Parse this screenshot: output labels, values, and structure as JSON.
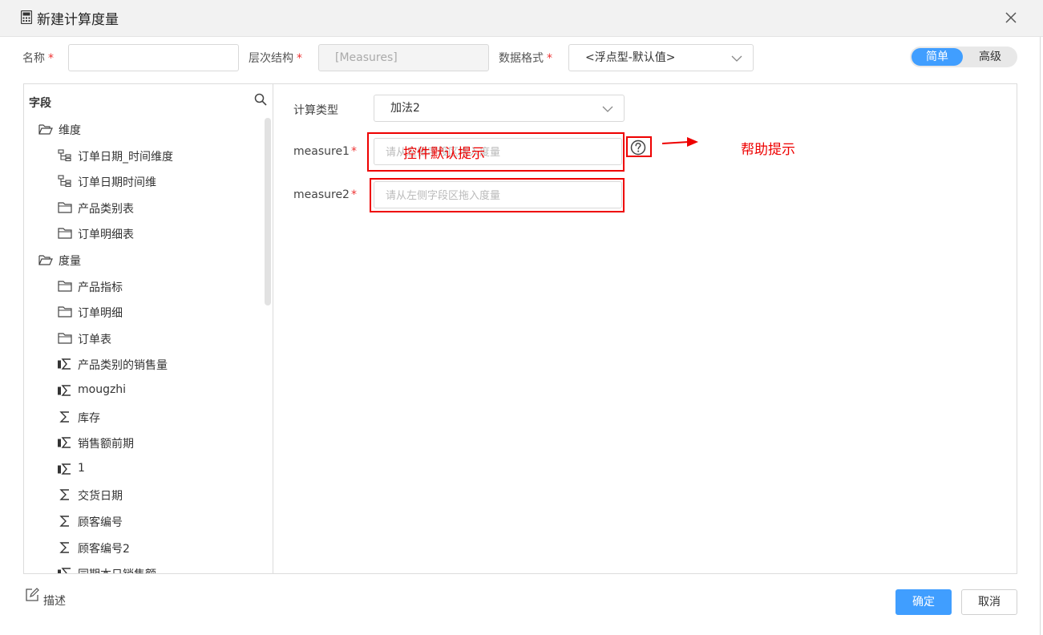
{
  "dialog": {
    "title": "新建计算度量"
  },
  "form": {
    "name_label": "名称",
    "name_value": "",
    "hierarchy_label": "层次结构",
    "hierarchy_value": "[Measures]",
    "format_label": "数据格式",
    "format_value": "<浮点型-默认值>",
    "required_mark": "*"
  },
  "mode_toggle": {
    "simple": "简单",
    "advanced": "高级"
  },
  "fields": {
    "title": "字段",
    "items": [
      {
        "label": "维度",
        "icon": "folder-open-icon"
      },
      {
        "label": "订单日期_时间维度",
        "icon": "hierarchy-icon"
      },
      {
        "label": "订单日期时间维",
        "icon": "hierarchy-icon"
      },
      {
        "label": "产品类别表",
        "icon": "folder-icon"
      },
      {
        "label": "订单明细表",
        "icon": "folder-icon"
      },
      {
        "label": "度量",
        "icon": "folder-open-icon"
      },
      {
        "label": "产品指标",
        "icon": "folder-icon"
      },
      {
        "label": "订单明细",
        "icon": "folder-icon"
      },
      {
        "label": "订单表",
        "icon": "folder-icon"
      },
      {
        "label": "产品类别的销售量",
        "icon": "calc-measure-icon"
      },
      {
        "label": "mougzhi",
        "icon": "calc-measure-icon"
      },
      {
        "label": "库存",
        "icon": "sigma-icon"
      },
      {
        "label": "销售额前期",
        "icon": "calc-measure-icon"
      },
      {
        "label": "1",
        "icon": "calc-measure-icon"
      },
      {
        "label": "交货日期",
        "icon": "sigma-icon"
      },
      {
        "label": "顾客编号",
        "icon": "sigma-icon"
      },
      {
        "label": "顾客编号2",
        "icon": "sigma-icon"
      },
      {
        "label": "同期本日销售额",
        "icon": "calc-measure-icon"
      }
    ]
  },
  "calc": {
    "type_label": "计算类型",
    "type_value": "加法2",
    "measure1_label": "measure1",
    "measure1_placeholder": "请从左侧字段区拖入度量",
    "measure2_label": "measure2",
    "measure2_placeholder": "请从左侧字段区拖入度量"
  },
  "annotations": {
    "control_hint": "控件默认提示",
    "help_hint": "帮助提示"
  },
  "footer": {
    "describe": "描述",
    "confirm": "确定",
    "cancel": "取消"
  },
  "colors": {
    "primary": "#409eff",
    "required": "#e33333",
    "annotation": "#e00000"
  }
}
